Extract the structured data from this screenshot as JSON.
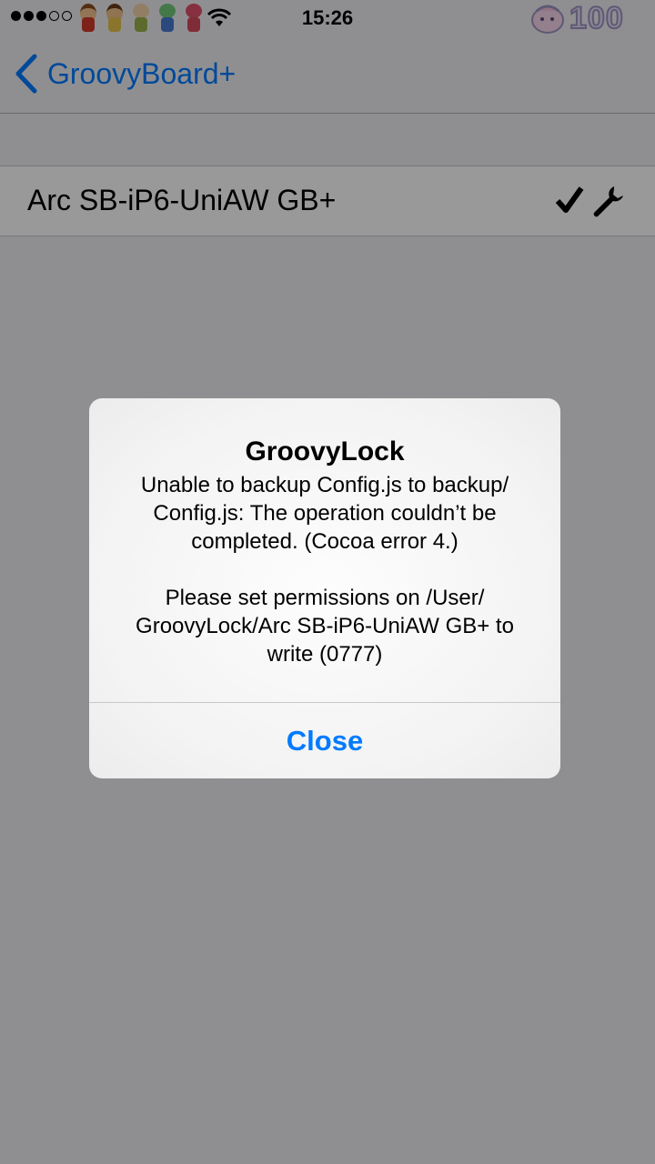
{
  "status_bar": {
    "time": "15:26",
    "signal_bars_filled": 3,
    "signal_bars_total": 5,
    "battery_text": "100",
    "icons": [
      "signal-dots-icon",
      "toy-figure-icons",
      "wifi-icon",
      "character-sticker-icon"
    ]
  },
  "nav": {
    "back_label": "GroovyBoard+"
  },
  "list": {
    "items": [
      {
        "label": "Arc SB-iP6-UniAW GB+",
        "icons": [
          "checkmark-icon",
          "wrench-icon"
        ]
      }
    ]
  },
  "alert": {
    "title": "GroovyLock",
    "message_1": "Unable to backup Config.js to backup/ Config.js: The operation couldn’t be completed. (Cocoa error 4.)",
    "message_2": "Please set permissions on /User/ GroovyLock/Arc SB-iP6-UniAW GB+ to write (0777)",
    "button_label": "Close"
  },
  "colors": {
    "accent": "#007aff",
    "background": "#efeff4",
    "overlay": "rgba(0,0,0,0.40)"
  }
}
